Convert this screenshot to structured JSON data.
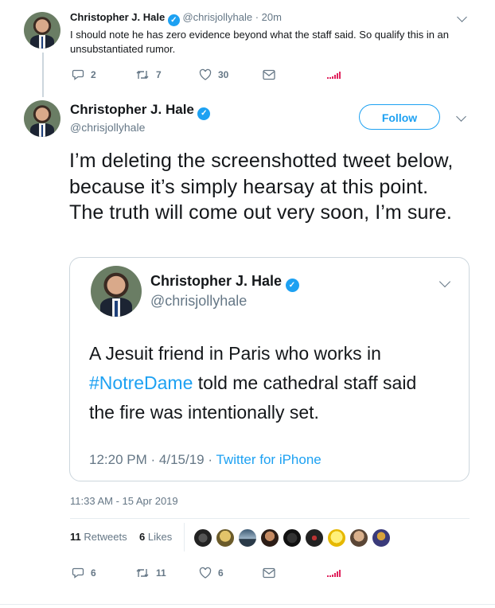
{
  "reply_tweet": {
    "name": "Christopher J. Hale",
    "handle": "@chrisjollyhale",
    "time": "20m",
    "text": "I should note he has zero evidence beyond what the staff said. So qualify this in an unsubstantiated rumor.",
    "replies": "2",
    "retweets": "7",
    "likes": "30"
  },
  "main_tweet": {
    "name": "Christopher J. Hale",
    "handle": "@chrisjollyhale",
    "follow_label": "Follow",
    "text": "I’m deleting the screenshotted tweet below, because it’s simply hearsay at this point. The truth will come out very soon, I’m sure.",
    "timestamp": "11:33 AM - 15 Apr 2019",
    "retweet_count": "11",
    "retweet_label": "Retweets",
    "like_count": "6",
    "like_label": "Likes",
    "replies": "6",
    "retweets": "11",
    "likes": "6"
  },
  "quoted_tweet": {
    "name": "Christopher J. Hale",
    "handle": "@chrisjollyhale",
    "text_before": "A Jesuit friend in Paris who works in ",
    "hashtag": "#NotreDame",
    "text_after": " told me cathedral staff said the fire was intentionally set.",
    "time": "12:20 PM",
    "date": "4/15/19",
    "source": "Twitter for iPhone"
  },
  "colors": {
    "accent": "#1da1f2",
    "muted": "#657786",
    "analytics": "#e0245e"
  }
}
